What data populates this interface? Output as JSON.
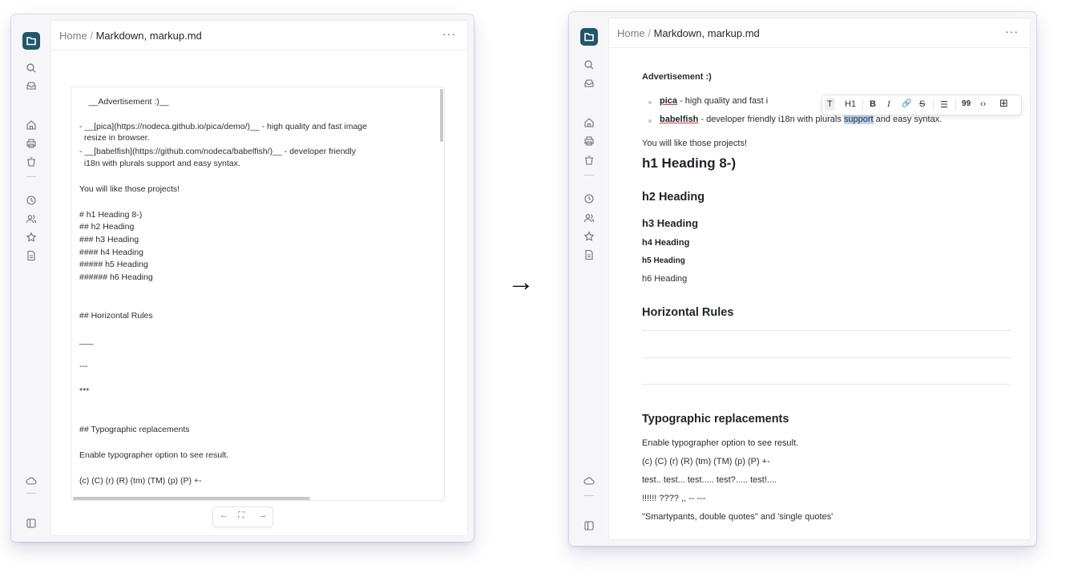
{
  "left_window": {
    "breadcrumb": {
      "home": "Home",
      "sep": "/",
      "file": "Markdown, markup.md"
    },
    "more": "···",
    "source_lines": [
      "    __Advertisement :)__",
      "- __[pica](https://nodeca.github.io/pica/demo/)__ - high quality and fast image",
      "  resize in browser.",
      "- __[babelfish](https://github.com/nodeca/babelfish/)__ - developer friendly",
      "  i18n with plurals support and easy syntax.",
      "You will like those projects!",
      "# h1 Heading 8-)",
      "## h2 Heading",
      "### h3 Heading",
      "#### h4 Heading",
      "##### h5 Heading",
      "###### h6 Heading",
      "## Horizontal Rules",
      "___",
      "---",
      "***",
      "## Typographic replacements",
      "Enable typographer option to see result.",
      "(c) (C) (r) (R) (tm) (TM) (p) (P) +-"
    ],
    "pager": {
      "prev": "←",
      "expand": "⛶",
      "next": "→"
    }
  },
  "arrow": "→",
  "right_window": {
    "breadcrumb": {
      "home": "Home",
      "sep": "/",
      "file": "Markdown, markup.md"
    },
    "more": "···",
    "advertisement": "Advertisement :)",
    "items": [
      {
        "link": "pica",
        "text_before": " - high quality and fast i"
      },
      {
        "link": "babelfish",
        "text_before": " - developer friendly i18n with plurals ",
        "selected": "support",
        "text_after": " and easy syntax."
      }
    ],
    "toolbar": {
      "text": "T",
      "h1": "H1",
      "bold": "B",
      "italic": "I",
      "link": "🔗",
      "strike": "S",
      "list": "☰",
      "quote": "99",
      "code": "‹›",
      "table": "⊞"
    },
    "you_like": "You will like those projects!",
    "h1": "h1 Heading 8-)",
    "h2": "h2 Heading",
    "h3": "h3 Heading",
    "h4": "h4 Heading",
    "h5": "h5 Heading",
    "h6": "h6 Heading",
    "hr_title": "Horizontal Rules",
    "typo_title": "Typographic replacements",
    "typo_lines": [
      "Enable typographer option to see result.",
      "(c) (C) (r) (R) (tm) (TM) (p) (P) +-",
      "test.. test... test..... test?..... test!....",
      "!!!!!! ???? ,, -- ---",
      "\"Smartypants, double quotes\" and 'single quotes'"
    ]
  },
  "colors": {
    "accent": "#22566a",
    "selection": "#bcd4f3",
    "link_underline": "#c43a3a"
  }
}
